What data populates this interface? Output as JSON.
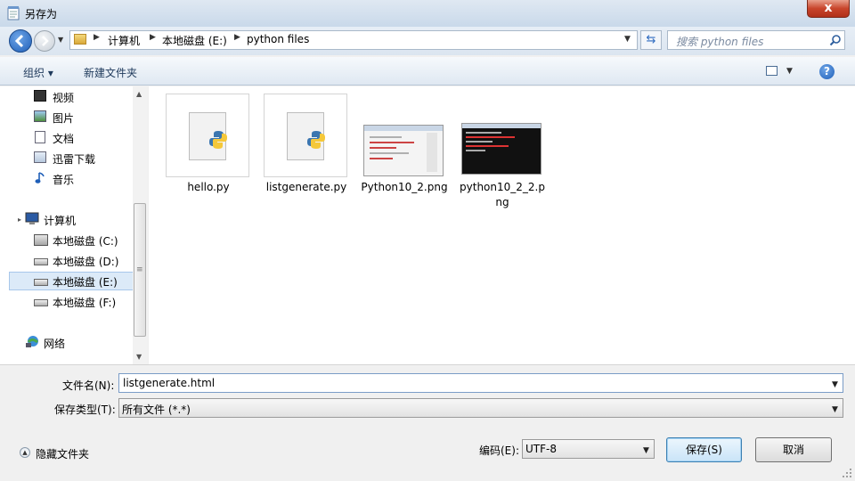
{
  "window": {
    "title": "另存为",
    "close_glyph": "x"
  },
  "address": {
    "crumbs": [
      "计算机",
      "本地磁盘 (E:)",
      "python files"
    ],
    "search_placeholder": "搜索 python files"
  },
  "toolbar": {
    "organize": "组织 ▾",
    "new_folder": "新建文件夹"
  },
  "nav": {
    "favorites": [
      {
        "label": "视频",
        "icon": "video-icon"
      },
      {
        "label": "图片",
        "icon": "picture-icon"
      },
      {
        "label": "文档",
        "icon": "document-icon"
      },
      {
        "label": "迅雷下载",
        "icon": "download-icon"
      },
      {
        "label": "音乐",
        "icon": "music-icon"
      }
    ],
    "computer": "计算机",
    "drives": [
      "本地磁盘 (C:)",
      "本地磁盘 (D:)",
      "本地磁盘 (E:)",
      "本地磁盘 (F:)"
    ],
    "selected_drive": "本地磁盘 (E:)",
    "network": "网络"
  },
  "files": [
    {
      "name": "hello.py",
      "kind": "python"
    },
    {
      "name": "listgenerate.py",
      "kind": "python"
    },
    {
      "name": "Python10_2.png",
      "kind": "image-light"
    },
    {
      "name": "python10_2_2.png",
      "kind": "image-dark"
    }
  ],
  "form": {
    "filename_label": "文件名(N):",
    "filename_value": "listgenerate.html",
    "type_label": "保存类型(T):",
    "type_value": "所有文件  (*.*)",
    "encoding_label": "编码(E):",
    "encoding_value": "UTF-8",
    "save_label": "保存(S)",
    "cancel_label": "取消",
    "hide_folders_label": "隐藏文件夹"
  }
}
